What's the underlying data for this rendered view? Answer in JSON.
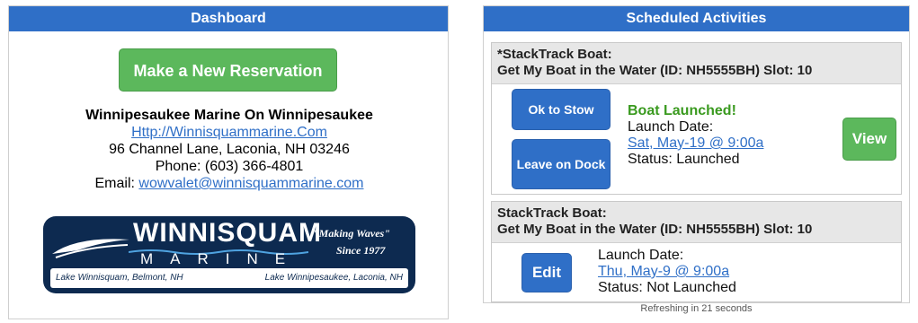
{
  "dashboard": {
    "title": "Dashboard",
    "reservation_button": "Make a New Reservation",
    "marina_name": "Winnipesaukee Marine On Winnipesaukee",
    "website": "Http://Winnisquammarine.Com",
    "address": "96 Channel Lane, Laconia, NH 03246",
    "phone": "Phone: (603) 366-4801",
    "email_label": "Email: ",
    "email": "wowvalet@winnisquammarine.com",
    "logo": {
      "word1": "WINNISQUAM",
      "word2": "MARINE",
      "tagline": "\"Making Waves\"",
      "since": "Since 1977",
      "loc_left": "Lake Winnisquam, Belmont, NH",
      "loc_right": "Lake Winnipesaukee, Laconia, NH"
    }
  },
  "scheduled": {
    "title": "Scheduled Activities",
    "activities": [
      {
        "line1": "*StackTrack Boat:",
        "line2": "Get My Boat in the Water (ID: NH5555BH) Slot: 10",
        "btn1": "Ok to Stow",
        "btn2": "Leave on Dock",
        "status_title": "Boat Launched!",
        "date_label": "Launch Date:",
        "date": "Sat, May-19 @ 9:00a",
        "status": "Status: Launched",
        "action": "View"
      },
      {
        "line1": "StackTrack Boat:",
        "line2": "Get My Boat in the Water (ID: NH5555BH) Slot: 10",
        "btn1": "Edit",
        "date_label": "Launch Date:",
        "date": "Thu, May-9 @ 9:00a",
        "status": "Status: Not Launched"
      }
    ],
    "refresh_text": "Refreshing in 21 seconds"
  },
  "colors": {
    "header_blue": "#2f6fc7",
    "green": "#5cb85c",
    "launched_green": "#3a9a1f"
  }
}
